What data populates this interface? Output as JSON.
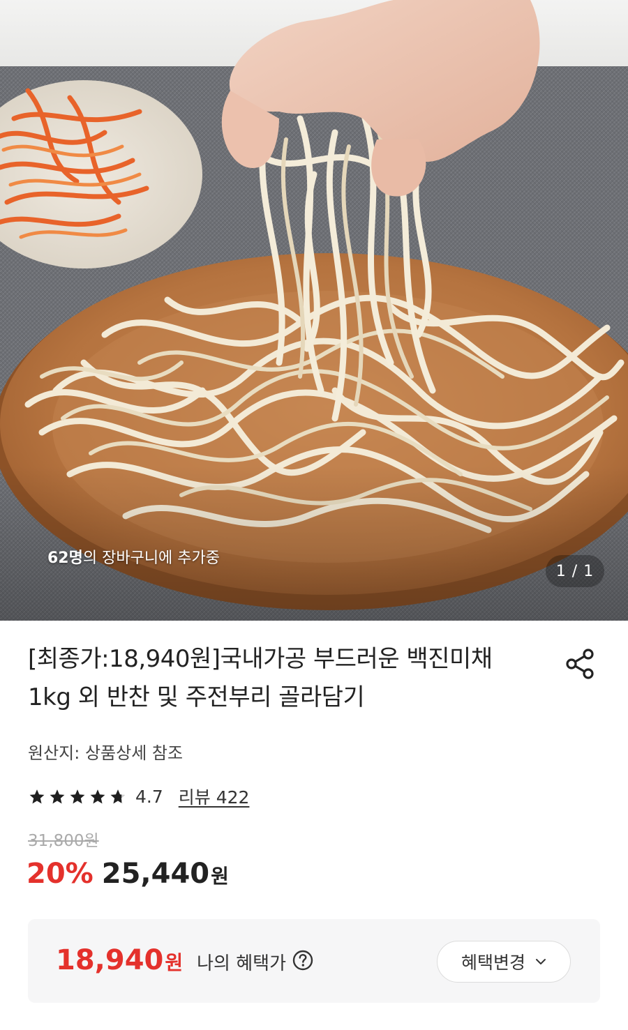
{
  "hero": {
    "cart_count": "62명",
    "cart_text": "의 장바구니에 추가중",
    "pager": "1 / 1"
  },
  "product": {
    "title": "[최종가:18,940원]국내가공 부드러운 백진미채 1kg 외 반찬 및 주전부리 골라담기",
    "origin": "원산지: 상품상세 참조",
    "rating": 4.7,
    "rating_text": "4.7",
    "review_label": "리뷰 422",
    "original_price": "31,800원",
    "discount": "20%",
    "sale_price": "25,440",
    "price_unit": "원"
  },
  "benefit": {
    "price": "18,940",
    "unit": "원",
    "label": "나의 혜택가",
    "change_button": "혜택변경"
  },
  "icons": {
    "share": "share-icon",
    "star": "star-icon",
    "help": "question-circle-icon",
    "chevron": "chevron-down-icon"
  },
  "colors": {
    "accent": "#e4312c",
    "star": "#1f1f1f",
    "benefit_bg": "#f6f6f7"
  }
}
